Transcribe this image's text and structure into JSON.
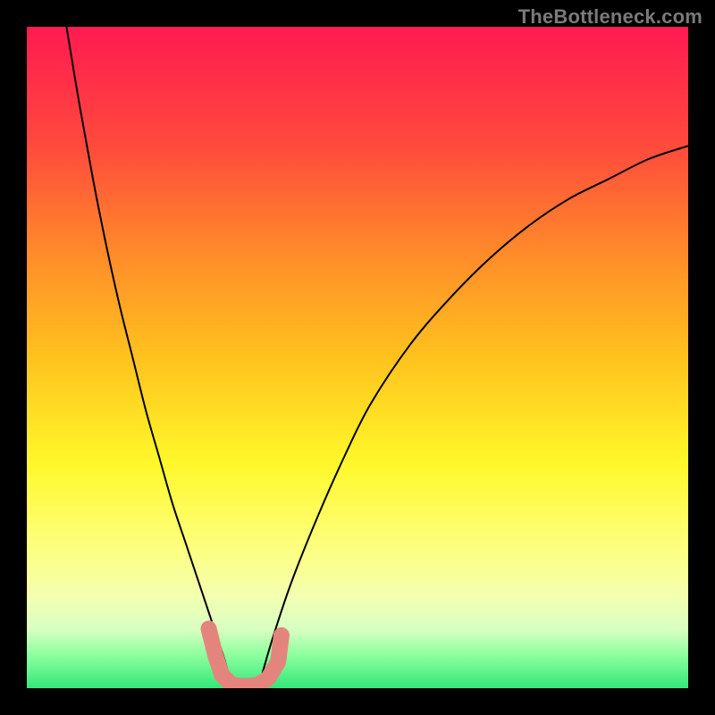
{
  "watermark": "TheBottleneck.com",
  "chart_data": {
    "type": "line",
    "title": "",
    "xlabel": "",
    "ylabel": "",
    "xlim": [
      0,
      100
    ],
    "ylim": [
      0,
      100
    ],
    "series": [
      {
        "name": "left-curve",
        "x": [
          6,
          8,
          10,
          12,
          14,
          16,
          18,
          20,
          22,
          24,
          26,
          28,
          30,
          31
        ],
        "y": [
          100,
          88,
          77,
          67,
          58,
          50,
          42,
          35,
          28,
          22,
          16,
          10,
          4,
          0
        ]
      },
      {
        "name": "right-curve",
        "x": [
          35,
          37,
          40,
          44,
          48,
          52,
          58,
          64,
          70,
          76,
          82,
          88,
          94,
          100
        ],
        "y": [
          0,
          7,
          16,
          26,
          35,
          43,
          52,
          59,
          65,
          70,
          74,
          77,
          80,
          82
        ]
      },
      {
        "name": "marker-cluster",
        "x": [
          27.5,
          28.5,
          29.5,
          31,
          33,
          35,
          36.5,
          38,
          38.5
        ],
        "y": [
          9,
          5,
          2,
          0.5,
          0.3,
          0.5,
          1.5,
          4,
          8
        ]
      }
    ],
    "background_gradient": {
      "stops": [
        {
          "pos": 0,
          "color": "#ff1a52"
        },
        {
          "pos": 18,
          "color": "#ff4a3c"
        },
        {
          "pos": 34,
          "color": "#ff8a2a"
        },
        {
          "pos": 50,
          "color": "#ffc21e"
        },
        {
          "pos": 66,
          "color": "#fff82a"
        },
        {
          "pos": 78,
          "color": "#fdff7a"
        },
        {
          "pos": 86,
          "color": "#f4ffb0"
        },
        {
          "pos": 91,
          "color": "#d9ffc2"
        },
        {
          "pos": 95,
          "color": "#8cff9e"
        },
        {
          "pos": 100,
          "color": "#34e77a"
        }
      ]
    },
    "colors": {
      "curve": "#000000",
      "markers": "#e4857d",
      "frame": "#000000"
    }
  }
}
